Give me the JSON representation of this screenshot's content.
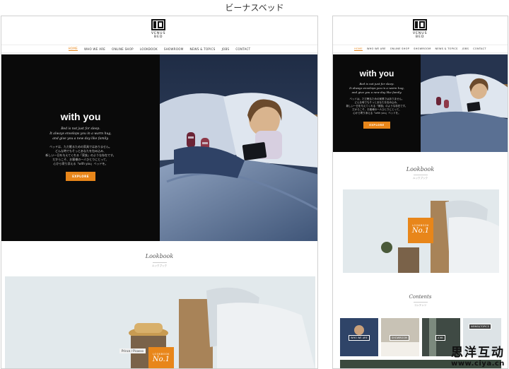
{
  "caption": "ビーナスベッド",
  "logo": {
    "line1": "VENUS",
    "line2": "BED"
  },
  "nav": {
    "items": [
      "HOME",
      "WHO WE ARE",
      "ONLINE SHOP",
      "LOOKBOOK",
      "SHOWROOM",
      "NEWS & TOPICS",
      "JOBS",
      "CONTACT"
    ],
    "mobile_items": [
      "HOME",
      "WHO WE ARE",
      "ONLINE SHOP",
      "SHOWROOM",
      "NEWS & TOPICS",
      "JOBS",
      "CONTACT"
    ],
    "active": "HOME"
  },
  "hero": {
    "title": "with you",
    "en_line1": "Bed is not just for sleep.",
    "en_line2": "It always envelops you in a warm hug,",
    "en_line3": "and give you a new day like family.",
    "jp_line1": "ベッドは、ただ眠るための家具ではありません。",
    "jp_line2": "どんな時でもそっとあなたを包み込み、",
    "jp_line3": "新しい一日を与えてくれる「家族」のような存在です。",
    "jp_line4": "だからこそ、お客様の一人ひとりにとって、",
    "jp_line5": "心から寄り添える「with you」ベッドを。",
    "button": "EXPLORE"
  },
  "lookbook": {
    "title": "Lookbook",
    "subtitle": "ルックブック",
    "badge_label": "LOOKBOOK",
    "badge_no": "No.1",
    "book_label": "Prince / Picasso"
  },
  "contents": {
    "title": "Contents",
    "subtitle": "コンテンツ",
    "tiles": [
      "WHO WE ARE",
      "SHOWROOM",
      "JOBS",
      "NEWS&TOPICS"
    ]
  },
  "watermark": {
    "cn": "思洋互动",
    "url": "www.ciya.cn"
  },
  "colors": {
    "accent": "#e8861a",
    "hero_bg": "#0a0a0a"
  }
}
